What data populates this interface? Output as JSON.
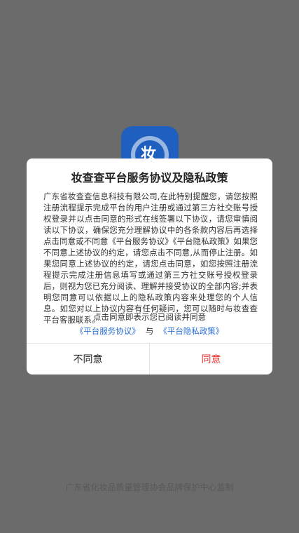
{
  "app_logo": {
    "glyph": "妆",
    "color": "#1f5fbf"
  },
  "footer": {
    "note": "广东省化妆品质量管理协会品牌保护中心监制"
  },
  "dialog": {
    "title": "妆查查平台服务协议及隐私政策",
    "body": "广东省妆查查信息科技有限公司,在此特别提醒您，请您按照注册流程提示完成平台的用户注册或通过第三方社交账号授权登录并以点击同意的形式在线签署以下协议，请您审慎阅读以下协议，确保您充分理解协议中的各条款内容后再选择点击同意或不同意《平台服务协议》《平台隐私政策》如果您不同意上述协议的约定，请您点击不同意,从而停止注册。如果您同意上述协议的约定，请您点击同意，如您按照注册流程提示完成注册信息填写或通过第三方社交账号授权登录后，则视为您已充分阅读、理解并接受协议的全部内容;并表明您同意可以依据以上的隐私政策内容来处理您的个人信息。如您对以上协议内容有任何疑问，您可以随时与妆查查平台客服联系。",
    "consent_text": "点击同意即表示您已阅读并同意",
    "service_agreement_link": "《平台服务协议》",
    "and_text": "与",
    "privacy_policy_link": "《平台隐私政策》",
    "decline_label": "不同意",
    "agree_label": "同意",
    "link_color": "#2b6fd6",
    "agree_color": "#e53935"
  }
}
